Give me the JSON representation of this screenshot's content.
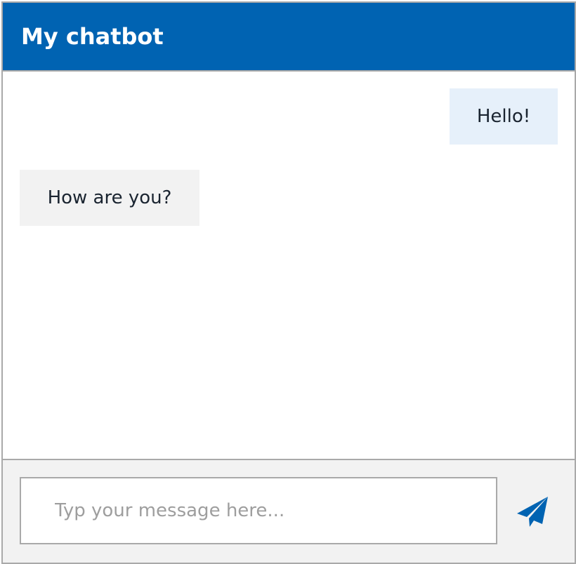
{
  "header": {
    "title": "My chatbot"
  },
  "messages": [
    {
      "sender": "user",
      "text": "Hello!"
    },
    {
      "sender": "bot",
      "text": "How are you?"
    }
  ],
  "composer": {
    "placeholder": "Typ your message here...",
    "value": "",
    "send_icon": "send-icon"
  },
  "colors": {
    "accent": "#0063b2",
    "user_bubble": "#e6f0fa",
    "bot_bubble": "#f2f2f2",
    "border": "#a9a9a9"
  }
}
